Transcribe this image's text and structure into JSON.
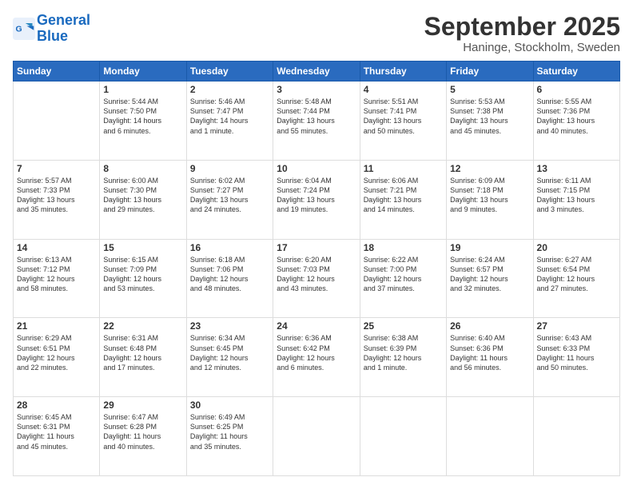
{
  "header": {
    "logo_line1": "General",
    "logo_line2": "Blue",
    "month": "September 2025",
    "location": "Haninge, Stockholm, Sweden"
  },
  "days_of_week": [
    "Sunday",
    "Monday",
    "Tuesday",
    "Wednesday",
    "Thursday",
    "Friday",
    "Saturday"
  ],
  "weeks": [
    [
      {
        "day": "",
        "info": ""
      },
      {
        "day": "1",
        "info": "Sunrise: 5:44 AM\nSunset: 7:50 PM\nDaylight: 14 hours\nand 6 minutes."
      },
      {
        "day": "2",
        "info": "Sunrise: 5:46 AM\nSunset: 7:47 PM\nDaylight: 14 hours\nand 1 minute."
      },
      {
        "day": "3",
        "info": "Sunrise: 5:48 AM\nSunset: 7:44 PM\nDaylight: 13 hours\nand 55 minutes."
      },
      {
        "day": "4",
        "info": "Sunrise: 5:51 AM\nSunset: 7:41 PM\nDaylight: 13 hours\nand 50 minutes."
      },
      {
        "day": "5",
        "info": "Sunrise: 5:53 AM\nSunset: 7:38 PM\nDaylight: 13 hours\nand 45 minutes."
      },
      {
        "day": "6",
        "info": "Sunrise: 5:55 AM\nSunset: 7:36 PM\nDaylight: 13 hours\nand 40 minutes."
      }
    ],
    [
      {
        "day": "7",
        "info": "Sunrise: 5:57 AM\nSunset: 7:33 PM\nDaylight: 13 hours\nand 35 minutes."
      },
      {
        "day": "8",
        "info": "Sunrise: 6:00 AM\nSunset: 7:30 PM\nDaylight: 13 hours\nand 29 minutes."
      },
      {
        "day": "9",
        "info": "Sunrise: 6:02 AM\nSunset: 7:27 PM\nDaylight: 13 hours\nand 24 minutes."
      },
      {
        "day": "10",
        "info": "Sunrise: 6:04 AM\nSunset: 7:24 PM\nDaylight: 13 hours\nand 19 minutes."
      },
      {
        "day": "11",
        "info": "Sunrise: 6:06 AM\nSunset: 7:21 PM\nDaylight: 13 hours\nand 14 minutes."
      },
      {
        "day": "12",
        "info": "Sunrise: 6:09 AM\nSunset: 7:18 PM\nDaylight: 13 hours\nand 9 minutes."
      },
      {
        "day": "13",
        "info": "Sunrise: 6:11 AM\nSunset: 7:15 PM\nDaylight: 13 hours\nand 3 minutes."
      }
    ],
    [
      {
        "day": "14",
        "info": "Sunrise: 6:13 AM\nSunset: 7:12 PM\nDaylight: 12 hours\nand 58 minutes."
      },
      {
        "day": "15",
        "info": "Sunrise: 6:15 AM\nSunset: 7:09 PM\nDaylight: 12 hours\nand 53 minutes."
      },
      {
        "day": "16",
        "info": "Sunrise: 6:18 AM\nSunset: 7:06 PM\nDaylight: 12 hours\nand 48 minutes."
      },
      {
        "day": "17",
        "info": "Sunrise: 6:20 AM\nSunset: 7:03 PM\nDaylight: 12 hours\nand 43 minutes."
      },
      {
        "day": "18",
        "info": "Sunrise: 6:22 AM\nSunset: 7:00 PM\nDaylight: 12 hours\nand 37 minutes."
      },
      {
        "day": "19",
        "info": "Sunrise: 6:24 AM\nSunset: 6:57 PM\nDaylight: 12 hours\nand 32 minutes."
      },
      {
        "day": "20",
        "info": "Sunrise: 6:27 AM\nSunset: 6:54 PM\nDaylight: 12 hours\nand 27 minutes."
      }
    ],
    [
      {
        "day": "21",
        "info": "Sunrise: 6:29 AM\nSunset: 6:51 PM\nDaylight: 12 hours\nand 22 minutes."
      },
      {
        "day": "22",
        "info": "Sunrise: 6:31 AM\nSunset: 6:48 PM\nDaylight: 12 hours\nand 17 minutes."
      },
      {
        "day": "23",
        "info": "Sunrise: 6:34 AM\nSunset: 6:45 PM\nDaylight: 12 hours\nand 12 minutes."
      },
      {
        "day": "24",
        "info": "Sunrise: 6:36 AM\nSunset: 6:42 PM\nDaylight: 12 hours\nand 6 minutes."
      },
      {
        "day": "25",
        "info": "Sunrise: 6:38 AM\nSunset: 6:39 PM\nDaylight: 12 hours\nand 1 minute."
      },
      {
        "day": "26",
        "info": "Sunrise: 6:40 AM\nSunset: 6:36 PM\nDaylight: 11 hours\nand 56 minutes."
      },
      {
        "day": "27",
        "info": "Sunrise: 6:43 AM\nSunset: 6:33 PM\nDaylight: 11 hours\nand 50 minutes."
      }
    ],
    [
      {
        "day": "28",
        "info": "Sunrise: 6:45 AM\nSunset: 6:31 PM\nDaylight: 11 hours\nand 45 minutes."
      },
      {
        "day": "29",
        "info": "Sunrise: 6:47 AM\nSunset: 6:28 PM\nDaylight: 11 hours\nand 40 minutes."
      },
      {
        "day": "30",
        "info": "Sunrise: 6:49 AM\nSunset: 6:25 PM\nDaylight: 11 hours\nand 35 minutes."
      },
      {
        "day": "",
        "info": ""
      },
      {
        "day": "",
        "info": ""
      },
      {
        "day": "",
        "info": ""
      },
      {
        "day": "",
        "info": ""
      }
    ]
  ]
}
